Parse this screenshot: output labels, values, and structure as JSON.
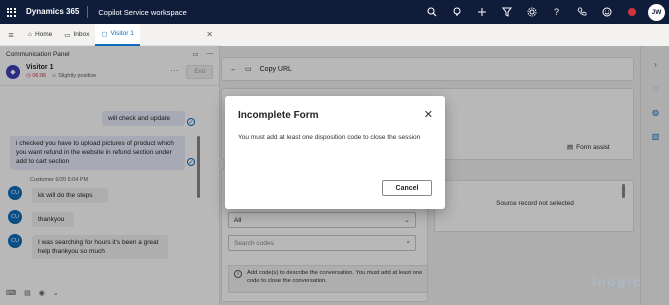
{
  "topbar": {
    "brand": "Dynamics 365",
    "app_name": "Copilot Service workspace",
    "user_initials": "JW"
  },
  "tabs": [
    {
      "label": "Home"
    },
    {
      "label": "Inbox"
    },
    {
      "label": "Visitor 1"
    }
  ],
  "communication_panel": {
    "title": "Communication Panel",
    "visitor_name": "Visitor 1",
    "timer": "06:06",
    "sentiment": "Slightly positive",
    "end_label": "End",
    "messages": {
      "agent_1": "will check and update",
      "agent_2": "i checked you have to upload pictures of product which you want refund in the website in refund section under add to cart section",
      "customer_meta": "Customer 6/20 5:04 PM",
      "customer_initials": "CU",
      "cust_1": "kk will do the steps",
      "cust_2": "thankyou",
      "cust_3": "I was searching for hours it's been a great help thankyou so much"
    }
  },
  "main": {
    "copy_url": "Copy URL",
    "form_assist": "Form assist",
    "dropdown_value": "All",
    "search_placeholder": "Search codes",
    "info_text": "Add code(s) to describe the conversation. You must add at least one code to close the conversation.",
    "source_record": "Source record not selected"
  },
  "dialog": {
    "title": "Incomplete Form",
    "body": "You must add at least one disposition code to close the session",
    "cancel": "Cancel"
  },
  "watermark": "Inogic",
  "colors": {
    "topbar": "#0f1d3a",
    "accent": "#0f6cbd",
    "agent_bubble": "#e8ebfa"
  }
}
